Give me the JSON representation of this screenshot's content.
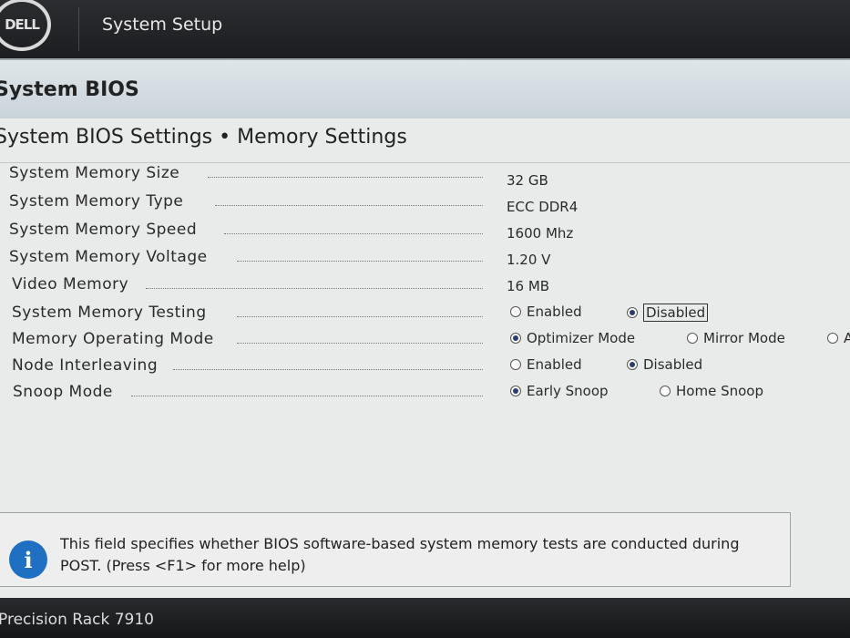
{
  "header": {
    "logo_text": "DELL",
    "app_title": "System Setup"
  },
  "section_title": "System BIOS",
  "page_title": "System BIOS Settings • Memory Settings",
  "fields": [
    {
      "label": "System Memory Size",
      "value": "32 GB"
    },
    {
      "label": "System Memory Type",
      "value": "ECC DDR4"
    },
    {
      "label": "System Memory Speed",
      "value": "1600 Mhz"
    },
    {
      "label": "System Memory Voltage",
      "value": "1.20 V"
    },
    {
      "label": "Video Memory",
      "value": "16 MB"
    }
  ],
  "radio_fields": [
    {
      "label": "System Memory Testing",
      "options": [
        "Enabled",
        "Disabled"
      ],
      "selected": "Disabled"
    },
    {
      "label": "Memory Operating Mode",
      "options": [
        "Optimizer Mode",
        "Mirror Mode",
        "A"
      ],
      "selected": "Optimizer Mode"
    },
    {
      "label": "Node Interleaving",
      "options": [
        "Enabled",
        "Disabled"
      ],
      "selected": "Disabled"
    },
    {
      "label": "Snoop Mode",
      "options": [
        "Early Snoop",
        "Home Snoop"
      ],
      "selected": "Early Snoop"
    }
  ],
  "help": {
    "icon": "info-icon",
    "text": "This field specifies whether BIOS software-based system memory tests are conducted during POST. (Press <F1> for more help)"
  },
  "footer": {
    "model": "Precision Rack 7910"
  },
  "colors": {
    "header_bg": "#1c1d20",
    "section_bg": "#c9d3da",
    "info_blue": "#1f6fc2"
  }
}
